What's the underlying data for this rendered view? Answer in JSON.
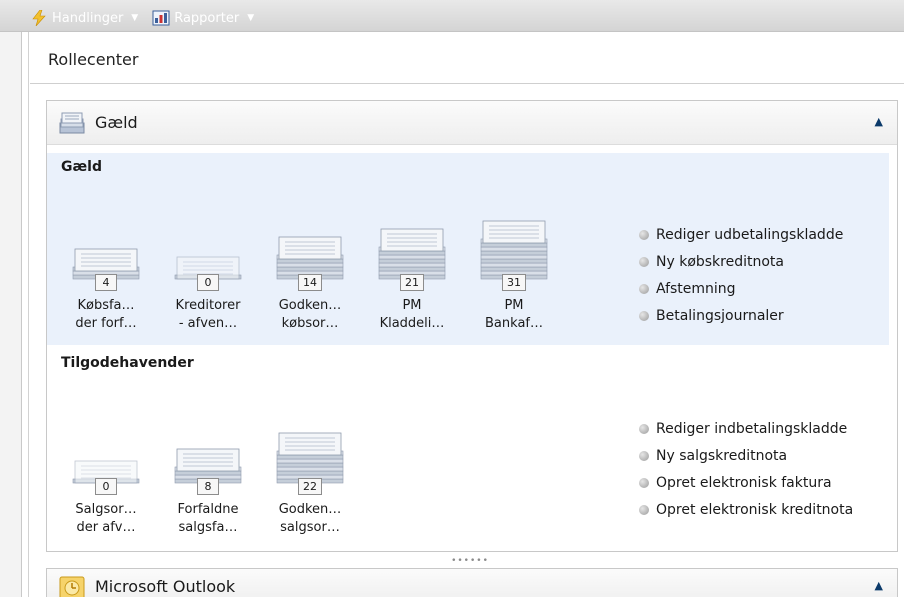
{
  "toolbar": {
    "actions_label": "Handlinger",
    "reports_label": "Rapporter"
  },
  "page": {
    "title": "Rollecenter"
  },
  "panel": {
    "title": "Gæld",
    "groups": [
      {
        "title": "Gæld",
        "tiles": [
          {
            "count": "4",
            "line1": "Købsfa…",
            "line2": "der forf…",
            "level": 0.2
          },
          {
            "count": "0",
            "line1": "Kreditorer",
            "line2": "- afven…",
            "level": 0.0
          },
          {
            "count": "14",
            "line1": "Godken…",
            "line2": "købsor…",
            "level": 0.55
          },
          {
            "count": "21",
            "line1": "PM",
            "line2": "Kladdeli…",
            "level": 0.8
          },
          {
            "count": "31",
            "line1": "PM",
            "line2": "Bankaf…",
            "level": 1.0
          }
        ],
        "actions": [
          "Rediger udbetalingskladde",
          "Ny købskreditnota",
          "Afstemning",
          "Betalingsjournaler"
        ]
      },
      {
        "title": "Tilgodehavender",
        "tiles": [
          {
            "count": "0",
            "line1": "Salgsor…",
            "line2": "der afv…",
            "level": 0.0
          },
          {
            "count": "8",
            "line1": "Forfaldne",
            "line2": "salgsfa…",
            "level": 0.35
          },
          {
            "count": "22",
            "line1": "Godken…",
            "line2": "salgsor…",
            "level": 0.8
          }
        ],
        "actions": [
          "Rediger indbetalingskladde",
          "Ny salgskreditnota",
          "Opret elektronisk faktura",
          "Opret elektronisk kreditnota"
        ]
      }
    ]
  },
  "panel2": {
    "title": "Microsoft Outlook"
  },
  "colors": {
    "accent": "#0b3a6a",
    "cue_bg": "#eaf1fb"
  }
}
